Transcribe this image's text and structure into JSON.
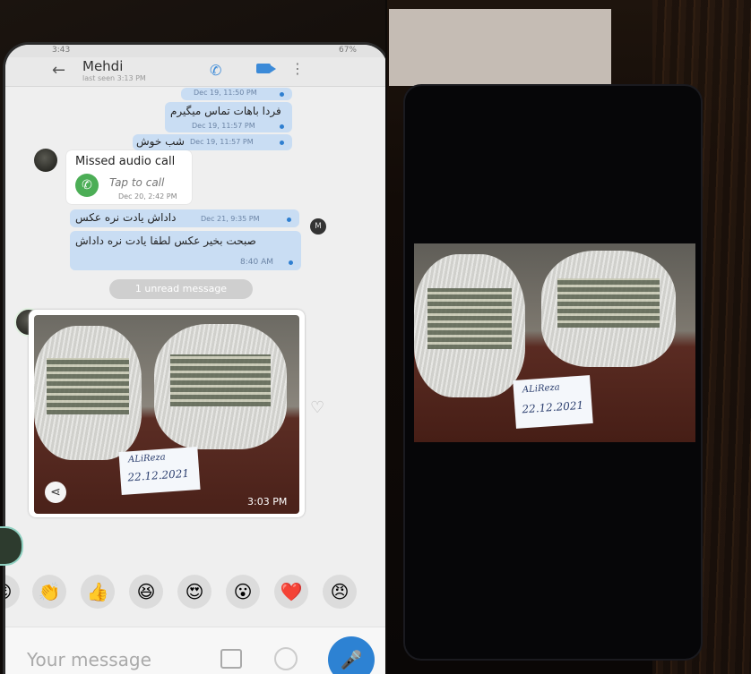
{
  "left_phone": {
    "status_bar": {
      "time": "3:43",
      "battery": "67%"
    },
    "header": {
      "contact_name": "Mehdi",
      "last_seen": "last seen 3:13 PM",
      "icons": [
        "back-arrow-icon",
        "phone-icon",
        "video-camera-icon",
        "more-vertical-icon"
      ]
    },
    "messages": [
      {
        "type": "outgoing",
        "text": "",
        "time": "Dec 19, 11:50 PM"
      },
      {
        "type": "outgoing",
        "text": "فردا باهات تماس میگیرم",
        "time": "Dec 19, 11:57 PM"
      },
      {
        "type": "outgoing",
        "text": "شب خوش",
        "time": "Dec 19, 11:57 PM"
      },
      {
        "type": "missed_call",
        "title": "Missed audio call",
        "action": "Tap to call",
        "time": "Dec 20, 2:42 PM"
      },
      {
        "type": "outgoing",
        "text": "داداش یادت نره عکس",
        "time": "Dec 21, 9:35 PM"
      },
      {
        "type": "outgoing",
        "text": "صبحت بخیر عکس لطفا یادت نره داداش",
        "time": "8:40 AM"
      }
    ],
    "sender_badge": "M",
    "unread_label": "1 unread message",
    "photo_message": {
      "note_name": "ALiReza",
      "note_date": "22.12.2021",
      "time": "3:03 PM"
    },
    "emoji_reactions": [
      "😉",
      "👏",
      "👍",
      "😆",
      "😍",
      "😮",
      "❤️",
      "😠"
    ],
    "input": {
      "placeholder": "Your message"
    }
  },
  "right_phone": {
    "photo": {
      "note_name": "ALiReza",
      "note_date": "22.12.2021"
    }
  }
}
